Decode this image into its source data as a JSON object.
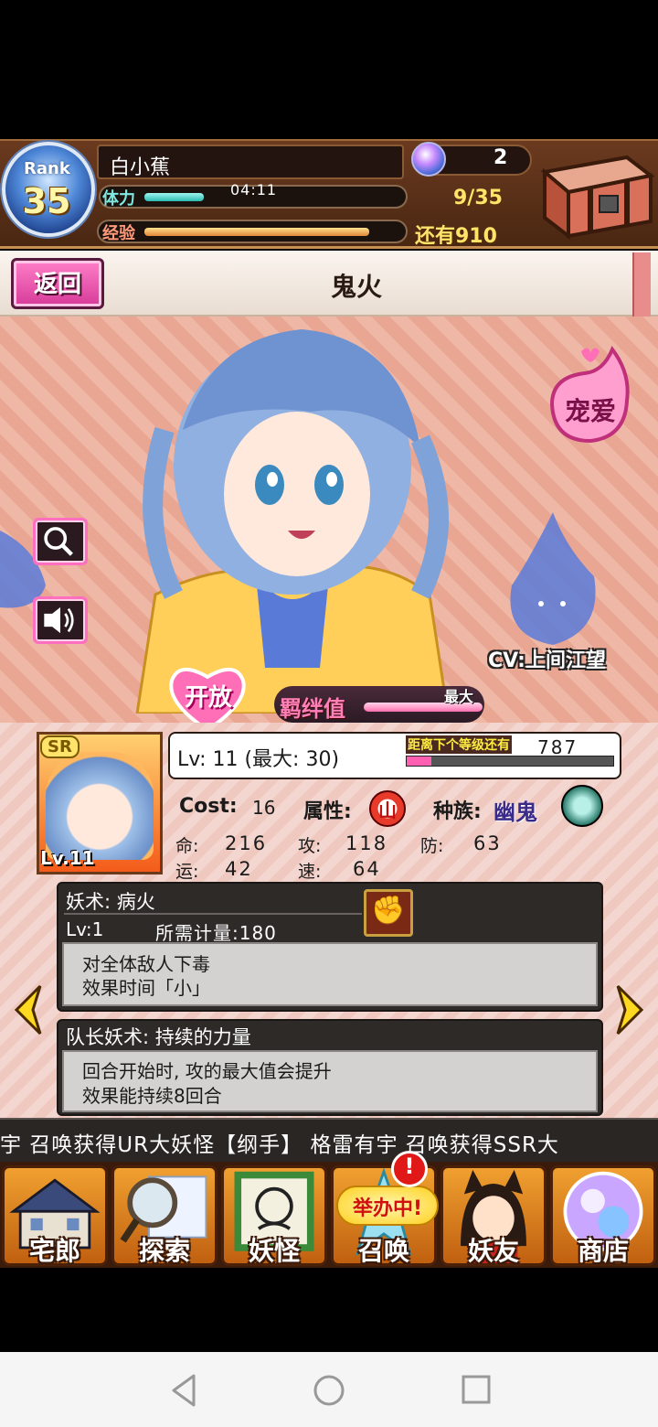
{
  "header": {
    "rank_label": "Rank",
    "rank_value": "35",
    "player_name": "白小蕉",
    "stamina_label": "体力",
    "stamina_timer": "04:11",
    "stamina_fill_fraction": 0.24,
    "stamina_count": "9/35",
    "exp_label": "经验",
    "exp_fill_fraction": 0.86,
    "exp_remaining": "还有910",
    "gem_count": "2"
  },
  "title_bar": {
    "back_label": "返回",
    "title": "鬼火"
  },
  "character": {
    "love_label": "宠爱",
    "cv": "CV:上间江望",
    "open_label": "开放",
    "bond_label": "羁绊值",
    "bond_max": "最大",
    "bond_fill_fraction": 1.0
  },
  "card": {
    "rarity": "SR",
    "level_badge": "Lv.11",
    "level_text": "Lv:  11 (最大: 30)",
    "next_label": "距离下个等级还有",
    "next_value": "787",
    "next_fill_fraction": 0.12
  },
  "stats": {
    "cost_label": "Cost:",
    "cost_value": "16",
    "attr_label": "属性:",
    "attr_glyph": "山",
    "race_label": "种族:",
    "race_value": "幽鬼",
    "hp_label": "命:",
    "hp_value": "216",
    "atk_label": "攻:",
    "atk_value": "118",
    "def_label": "防:",
    "def_value": "63",
    "luck_label": "运:",
    "luck_value": "42",
    "spd_label": "速:",
    "spd_value": "64"
  },
  "skill": {
    "title": "妖术: 病火",
    "level": "Lv:1",
    "cost": "所需计量:180",
    "desc_1": "对全体敌人下毒",
    "desc_2": "效果时间「小」"
  },
  "leader_skill": {
    "title": "队长妖术: 持续的力量",
    "desc_1": "回合开始时, 攻的最大值会提升",
    "desc_2": "效果能持续8回合"
  },
  "ticker": {
    "text": "宇 召唤获得UR大妖怪【纲手】   格雷有宇 召唤获得SSR大"
  },
  "nav": {
    "home": "宅郎",
    "explore": "探索",
    "yokai": "妖怪",
    "summon": "召唤",
    "friends": "妖友",
    "shop": "商店",
    "event_badge": "举办中!",
    "alert": "!"
  },
  "colors": {
    "accent_pink": "#ff5fb0",
    "header_brown": "#6b3a1f",
    "stamina_teal": "#2cbab0",
    "gold_text": "#ffe36b"
  }
}
